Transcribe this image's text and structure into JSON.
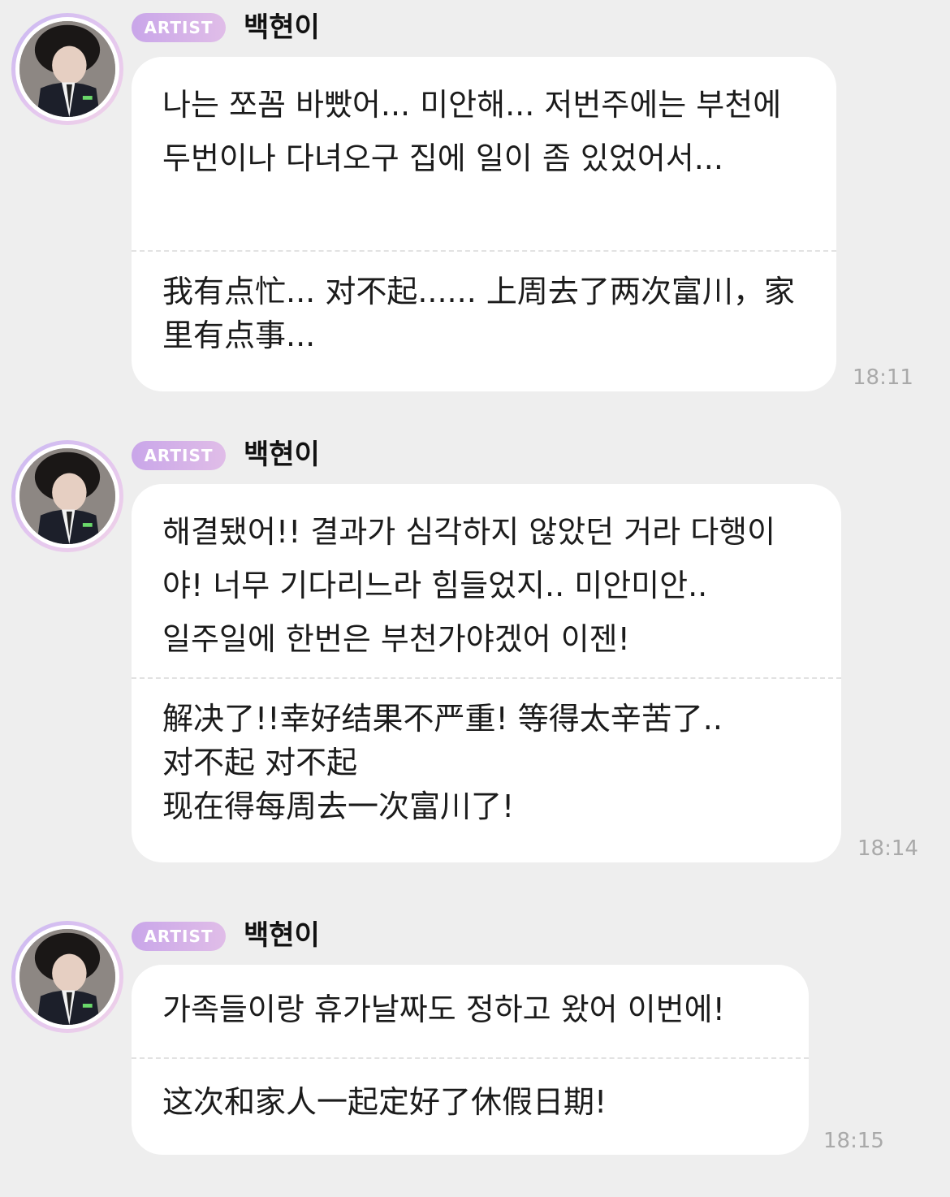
{
  "messages": [
    {
      "badge": "ARTIST",
      "sender": "백현이",
      "korean": "나는 쪼꼼 바빴어... 미안해... 저번주에는 부천에 두번이나 다녀오구 집에 일이 좀 있었어서...",
      "chinese": "我有点忙... 对不起...... 上周去了两次富川，家里有点事...",
      "time": "18:11"
    },
    {
      "badge": "ARTIST",
      "sender": "백현이",
      "korean": "해결됐어!! 결과가 심각하지 않았던 거라 다행이야! 너무 기다리느라 힘들었지.. 미안미안..\n일주일에 한번은 부천가야겠어 이젠!",
      "chinese": "解决了!!幸好结果不严重! 等得太辛苦了..\n对不起 对不起\n现在得每周去一次富川了!",
      "time": "18:14"
    },
    {
      "badge": "ARTIST",
      "sender": "백현이",
      "korean": "가족들이랑 휴가날짜도 정하고 왔어 이번에!",
      "chinese": "这次和家人一起定好了休假日期!",
      "time": "18:15"
    }
  ],
  "colors": {
    "background": "#eeeeee",
    "bubble": "#ffffff",
    "badge_gradient_start": "#c9a6e9",
    "badge_gradient_end": "#e0bde8",
    "timestamp": "#a9a9a9"
  },
  "icons": {
    "avatar": "artist-profile-photo"
  }
}
